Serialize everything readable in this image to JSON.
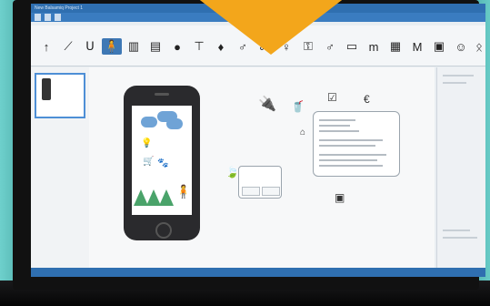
{
  "colors": {
    "accent_orange": "#f3a61b",
    "titlebar_blue": "#2f6fb0",
    "tree_green": "#4aa36a",
    "cloud_blue": "#6fa3d6",
    "wall_teal": "#6ed0cc"
  },
  "app": {
    "title": "New Balsamiq Project 1"
  },
  "toolbar": {
    "icons": [
      "up-arrow-icon",
      "magic-wand-icon",
      "magnet-icon",
      "person-icon",
      "book-icon",
      "map-icon",
      "pin-icon",
      "signpost-icon",
      "location-icon",
      "male-icon",
      "hierarchy-icon",
      "female-icon",
      "key-icon",
      "male-icon",
      "text-input-icon",
      "m-icon",
      "grid-icon",
      "m-icon",
      "lock-icon",
      "smiley-icon",
      "plug-icon"
    ]
  },
  "canvas": {
    "icons": [
      "plug-icon",
      "cup-icon",
      "checkbox-icon",
      "euro-icon",
      "home-icon",
      "cart-icon",
      "tree-icon",
      "person-icon",
      "lightbulb-icon",
      "leaf-icon",
      "bag-icon"
    ]
  }
}
